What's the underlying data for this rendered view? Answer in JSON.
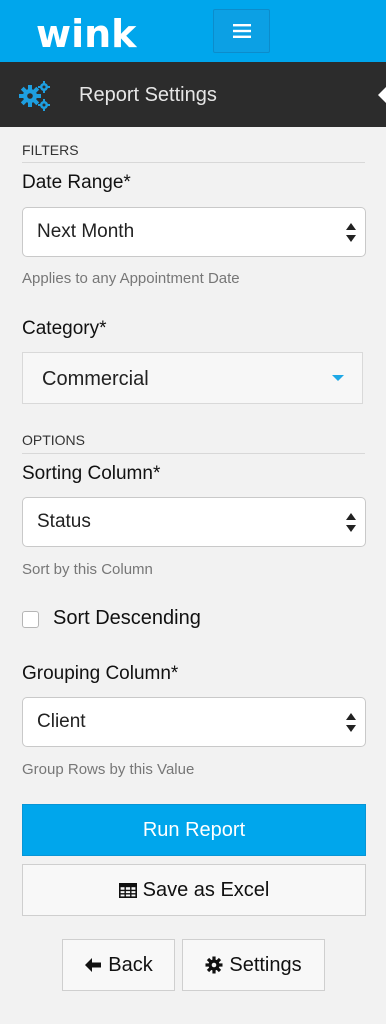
{
  "header": {
    "logo_text": "wink",
    "menu_icon": "hamburger-icon"
  },
  "settings_bar": {
    "title": "Report Settings",
    "icon": "gears-icon"
  },
  "filters": {
    "heading": "FILTERS",
    "date_range": {
      "label": "Date Range*",
      "value": "Next Month",
      "help": "Applies to any Appointment Date"
    },
    "category": {
      "label": "Category*",
      "value": "Commercial"
    }
  },
  "options": {
    "heading": "OPTIONS",
    "sorting": {
      "label": "Sorting Column*",
      "value": "Status",
      "help": "Sort by this Column"
    },
    "sort_descending": {
      "label": "Sort Descending",
      "checked": false
    },
    "grouping": {
      "label": "Grouping Column*",
      "value": "Client",
      "help": "Group Rows by this Value"
    }
  },
  "actions": {
    "run_report": "Run Report",
    "save_excel": "Save as Excel",
    "back": "Back",
    "settings": "Settings"
  },
  "colors": {
    "brand": "#00a6ec",
    "dark_bar": "#2c2c2c",
    "background": "#f2f2f2"
  }
}
